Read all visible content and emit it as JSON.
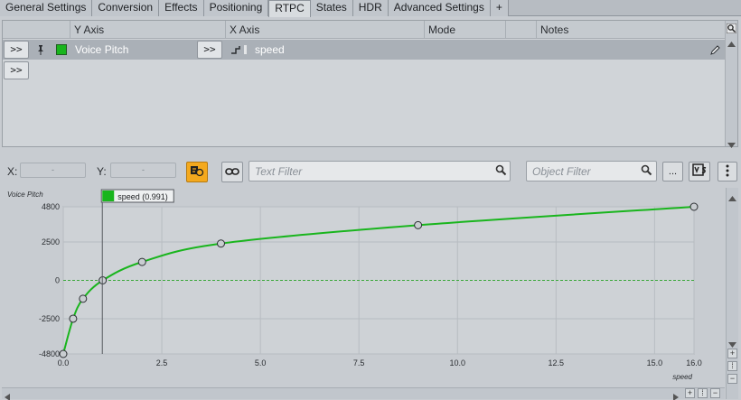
{
  "tabs": [
    {
      "label": "General Settings",
      "active": false
    },
    {
      "label": "Conversion",
      "active": false
    },
    {
      "label": "Effects",
      "active": false
    },
    {
      "label": "Positioning",
      "active": false
    },
    {
      "label": "RTPC",
      "active": true
    },
    {
      "label": "States",
      "active": false
    },
    {
      "label": "HDR",
      "active": false
    },
    {
      "label": "Advanced Settings",
      "active": false
    },
    {
      "label": "+",
      "active": false
    }
  ],
  "rtpc_table": {
    "columns": {
      "y_axis": "Y Axis",
      "x_axis": "X Axis",
      "mode": "Mode",
      "notes": "Notes"
    },
    "row": {
      "y_axis": "Voice Pitch",
      "x_axis": "speed",
      "color": "#19b51d"
    },
    "expand_label": ">>"
  },
  "toolbar": {
    "x_label": "X:",
    "y_label": "Y:",
    "x_value": "-",
    "y_value": "-",
    "text_filter_placeholder": "Text Filter",
    "object_filter_placeholder": "Object Filter",
    "more_label": "..."
  },
  "chart_data": {
    "type": "line",
    "ylabel": "Voice Pitch",
    "xlabel": "speed",
    "xlim": [
      0,
      16
    ],
    "ylim": [
      -4800,
      4800
    ],
    "x_ticks": [
      "0.0",
      "2.5",
      "5.0",
      "7.5",
      "10.0",
      "12.5",
      "15.0",
      "16.0"
    ],
    "y_ticks": [
      "4800",
      "2500",
      "0",
      "-2500",
      "-4800"
    ],
    "cursor": {
      "x": 0.991,
      "label": "speed (0.991)"
    },
    "series": [
      {
        "color": "#19b51d",
        "points": [
          [
            0,
            -4800
          ],
          [
            0.25,
            -2500
          ],
          [
            0.5,
            -1200
          ],
          [
            1,
            0
          ],
          [
            2,
            1200
          ],
          [
            4,
            2400
          ],
          [
            9,
            3600
          ],
          [
            16,
            4800
          ]
        ]
      }
    ]
  }
}
